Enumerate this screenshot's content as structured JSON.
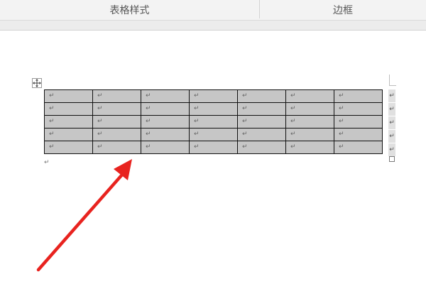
{
  "ribbon": {
    "groups": [
      {
        "label": "表格样式"
      },
      {
        "label": "边框"
      }
    ]
  },
  "table": {
    "rows": 5,
    "cols": 7,
    "cell_mark": "↵",
    "row_end_mark": "↵",
    "cell_fill": "#c6c6c6",
    "border_color": "#111111"
  },
  "document": {
    "paragraph_mark": "↵"
  },
  "colors": {
    "annotation_arrow": "#e8231f"
  }
}
